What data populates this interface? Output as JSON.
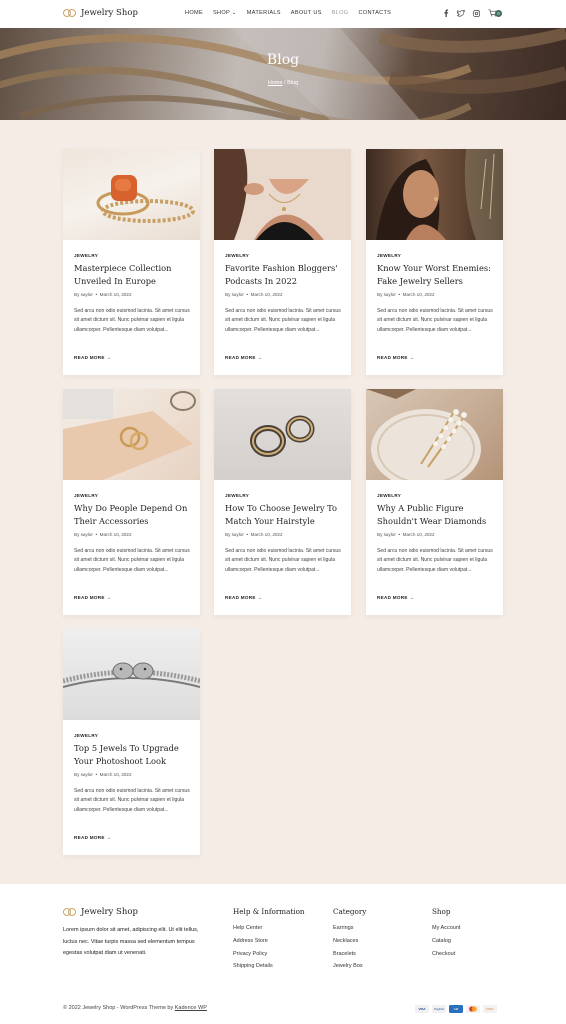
{
  "header": {
    "brand": "Jewelry Shop",
    "nav": [
      "HOME",
      "SHOP",
      "MATERIALS",
      "ABOUT US",
      "BLOG",
      "CONTACTS"
    ],
    "active_nav": "BLOG",
    "cart_count": "0",
    "icons": [
      "facebook-icon",
      "twitter-icon",
      "instagram-icon",
      "cart-icon"
    ]
  },
  "hero": {
    "title": "Blog",
    "breadcrumb_home": "Home",
    "breadcrumb_sep": " / ",
    "breadcrumb_current": "Blog"
  },
  "posts": [
    {
      "category": "JEWELRY",
      "title": "Masterpiece Collection Unveiled In Europe",
      "author": "By saylor",
      "date": "March 10, 2022",
      "excerpt": "Sed arcu non odio euismod lacinia. Sit amet cursus sit amet dictum sit. Nunc pulvinar sapien et ligula ullamcorper. Pellentesque diam volutpat...",
      "more": "READ MORE"
    },
    {
      "category": "JEWELRY",
      "title": "Favorite Fashion Bloggers' Podcasts In 2022",
      "author": "By saylor",
      "date": "March 10, 2022",
      "excerpt": "Sed arcu non odio euismod lacinia. Sit amet cursus sit amet dictum sit. Nunc pulvinar sapien et ligula ullamcorper. Pellentesque diam volutpat...",
      "more": "READ MORE"
    },
    {
      "category": "JEWELRY",
      "title": "Know Your Worst Enemies: Fake Jewelry Sellers",
      "author": "By saylor",
      "date": "March 10, 2022",
      "excerpt": "Sed arcu non odio euismod lacinia. Sit amet cursus sit amet dictum sit. Nunc pulvinar sapien et ligula ullamcorper. Pellentesque diam volutpat...",
      "more": "READ MORE"
    },
    {
      "category": "JEWELRY",
      "title": "Why Do People Depend On Their Accessories",
      "author": "By saylor",
      "date": "March 10, 2022",
      "excerpt": "Sed arcu non odio euismod lacinia. Sit amet cursus sit amet dictum sit. Nunc pulvinar sapien et ligula ullamcorper. Pellentesque diam volutpat...",
      "more": "READ MORE"
    },
    {
      "category": "JEWELRY",
      "title": "How To Choose Jewelry To Match Your Hairstyle",
      "author": "By saylor",
      "date": "March 10, 2022",
      "excerpt": "Sed arcu non odio euismod lacinia. Sit amet cursus sit amet dictum sit. Nunc pulvinar sapien et ligula ullamcorper. Pellentesque diam volutpat...",
      "more": "READ MORE"
    },
    {
      "category": "JEWELRY",
      "title": "Why A Public Figure Shouldn't Wear Diamonds",
      "author": "By saylor",
      "date": "March 10, 2022",
      "excerpt": "Sed arcu non odio euismod lacinia. Sit amet cursus sit amet dictum sit. Nunc pulvinar sapien et ligula ullamcorper. Pellentesque diam volutpat...",
      "more": "READ MORE"
    },
    {
      "category": "JEWELRY",
      "title": "Top 5 Jewels To Upgrade Your Photoshoot Look",
      "author": "By saylor",
      "date": "March 10, 2022",
      "excerpt": "Sed arcu non odio euismod lacinia. Sit amet cursus sit amet dictum sit. Nunc pulvinar sapien et ligula ullamcorper. Pellentesque diam volutpat...",
      "more": "READ MORE"
    }
  ],
  "footer": {
    "brand": "Jewelry Shop",
    "about": "Lorem ipsum dolor sit amet, adipiscing elit. Ut elit tellus, luctus nec. Vitae turpis massa sed elementum tempus egestas volutpat diam ut venenati.",
    "columns": [
      {
        "heading": "Help & Information",
        "links": [
          "Help Center",
          "Address Store",
          "Privacy Policy",
          "Shipping Details"
        ]
      },
      {
        "heading": "Category",
        "links": [
          "Earrings",
          "Necklaces",
          "Bracelets",
          "Jewelry Box"
        ]
      },
      {
        "heading": "Shop",
        "links": [
          "My Account",
          "Catalog",
          "Checkout"
        ]
      }
    ],
    "copyright": "© 2022 Jewelry Shop - WordPress Theme by ",
    "theme_link": "Kadence WP",
    "payments": [
      "VISA",
      "PayPal",
      "Amex",
      "MC",
      "Discover"
    ]
  }
}
